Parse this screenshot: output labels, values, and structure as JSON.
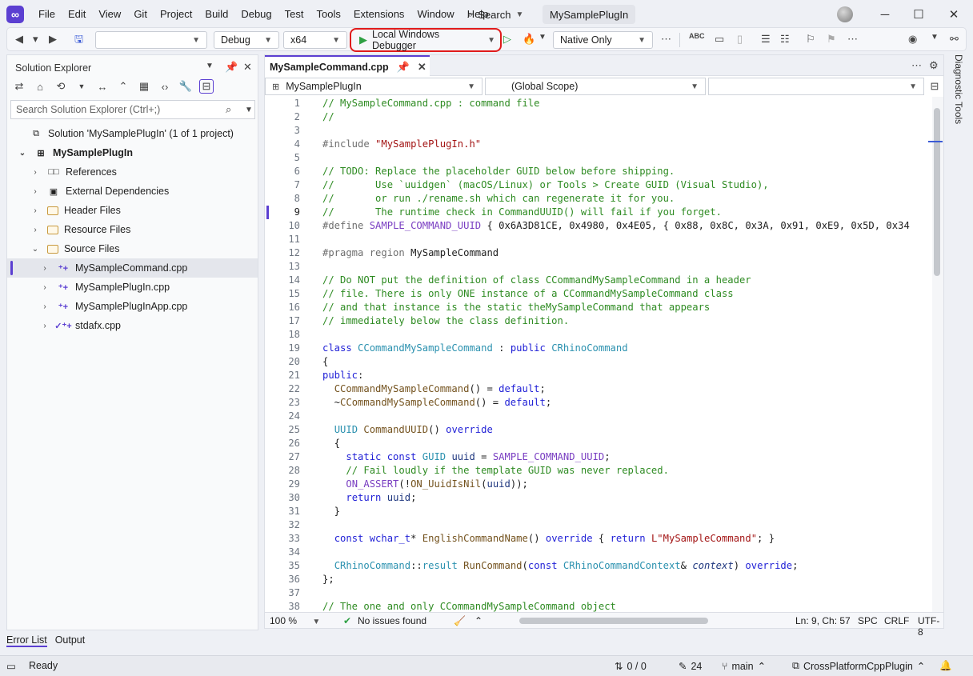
{
  "menu": [
    "File",
    "Edit",
    "View",
    "Git",
    "Project",
    "Build",
    "Debug",
    "Test",
    "Tools",
    "Extensions",
    "Window",
    "Help"
  ],
  "search_label": "Search",
  "solution_name": "MySamplePlugIn",
  "toolbar": {
    "config": "Debug",
    "platform": "x64",
    "debugger": "Local Windows Debugger",
    "debug_mode": "Native Only"
  },
  "solution_explorer": {
    "title": "Solution Explorer",
    "search_placeholder": "Search Solution Explorer (Ctrl+;)",
    "solution_label": "Solution 'MySamplePlugIn' (1 of 1 project)",
    "project": "MySamplePlugIn",
    "items": [
      {
        "label": "References",
        "icon": "references-icon"
      },
      {
        "label": "External Dependencies",
        "icon": "external-dependencies-icon"
      },
      {
        "label": "Header Files",
        "icon": "folder-icon"
      },
      {
        "label": "Resource Files",
        "icon": "folder-icon"
      },
      {
        "label": "Source Files",
        "icon": "folder-icon"
      }
    ],
    "files": [
      {
        "label": "MySampleCommand.cpp",
        "selected": true
      },
      {
        "label": "MySamplePlugIn.cpp"
      },
      {
        "label": "MySamplePlugInApp.cpp"
      },
      {
        "label": "stdafx.cpp"
      }
    ]
  },
  "bottom_tabs": [
    "Error List",
    "Output"
  ],
  "editor": {
    "tab": "MySampleCommand.cpp",
    "project_combo": "MySamplePlugIn",
    "scope_combo": "(Global Scope)",
    "zoom": "100 %",
    "issues": "No issues found",
    "position": "Ln: 9, Ch: 57",
    "whitespace": "SPC",
    "line_endings": "CRLF",
    "encoding": "UTF-8"
  },
  "code_lines": [
    {
      "n": "1",
      "html": "<span class='c'>// MySampleCommand.cpp : command file</span>"
    },
    {
      "n": "2",
      "html": "<span class='c'>//</span>"
    },
    {
      "n": "3",
      "html": ""
    },
    {
      "n": "4",
      "html": "<span class='pp'>#include</span> <span class='s'>\"MySamplePlugIn.h\"</span>"
    },
    {
      "n": "5",
      "html": ""
    },
    {
      "n": "6",
      "html": "<span class='c'>// TODO: Replace the placeholder GUID below before shipping.</span>"
    },
    {
      "n": "7",
      "html": "<span class='c'>//       Use `uuidgen` (macOS/Linux) or Tools &gt; Create GUID (Visual Studio),</span>"
    },
    {
      "n": "8",
      "html": "<span class='c'>//       or run ./rename.sh which can regenerate it for you.</span>"
    },
    {
      "n": "9",
      "html": "<span class='c'>//       The runtime check in CommandUUID() will fail if you forget.</span>"
    },
    {
      "n": "10",
      "html": "<span class='pp'>#define</span> <span class='m'>SAMPLE_COMMAND_UUID</span> { 0x6A3D81CE, 0x4980, 0x4E05, { 0x88, 0x8C, 0x3A, 0x91, 0xE9, 0x5D, 0x34"
    },
    {
      "n": "11",
      "html": ""
    },
    {
      "n": "12",
      "html": "<span class='pp'>#pragma region</span> MySampleCommand"
    },
    {
      "n": "13",
      "html": ""
    },
    {
      "n": "14",
      "html": "<span class='c'>// Do NOT put the definition of class CCommandMySampleCommand in a header</span>"
    },
    {
      "n": "15",
      "html": "<span class='c'>// file. There is only ONE instance of a CCommandMySampleCommand class</span>"
    },
    {
      "n": "16",
      "html": "<span class='c'>// and that instance is the static theMySampleCommand that appears</span>"
    },
    {
      "n": "17",
      "html": "<span class='c'>// immediately below the class definition.</span>"
    },
    {
      "n": "18",
      "html": ""
    },
    {
      "n": "19",
      "html": "<span class='k'>class</span> <span class='t'>CCommandMySampleCommand</span> : <span class='k'>public</span> <span class='t'>CRhinoCommand</span>"
    },
    {
      "n": "20",
      "html": "{"
    },
    {
      "n": "21",
      "html": "<span class='k'>public</span>:"
    },
    {
      "n": "22",
      "html": "  <span class='f'>CCommandMySampleCommand</span>() = <span class='k'>default</span>;"
    },
    {
      "n": "23",
      "html": "  ~<span class='f'>CCommandMySampleCommand</span>() = <span class='k'>default</span>;"
    },
    {
      "n": "24",
      "html": ""
    },
    {
      "n": "25",
      "html": "  <span class='t'>UUID</span> <span class='f'>CommandUUID</span>() <span class='k'>override</span>"
    },
    {
      "n": "26",
      "html": "  {"
    },
    {
      "n": "27",
      "html": "    <span class='k'>static const</span> <span class='t'>GUID</span> <span class='v'>uuid</span> = <span class='m'>SAMPLE_COMMAND_UUID</span>;"
    },
    {
      "n": "28",
      "html": "    <span class='c'>// Fail loudly if the template GUID was never replaced.</span>"
    },
    {
      "n": "29",
      "html": "    <span class='m'>ON_ASSERT</span>(!<span class='f'>ON_UuidIsNil</span>(<span class='v'>uuid</span>));"
    },
    {
      "n": "30",
      "html": "    <span class='k'>return</span> <span class='v'>uuid</span>;"
    },
    {
      "n": "31",
      "html": "  }"
    },
    {
      "n": "32",
      "html": ""
    },
    {
      "n": "33",
      "html": "  <span class='k'>const</span> <span class='k'>wchar_t</span>* <span class='f'>EnglishCommandName</span>() <span class='k'>override</span> { <span class='k'>return</span> <span class='s'>L\"MySampleCommand\"</span>; }"
    },
    {
      "n": "34",
      "html": ""
    },
    {
      "n": "35",
      "html": "  <span class='t'>CRhinoCommand</span>::<span class='t'>result</span> <span class='f'>RunCommand</span>(<span class='k'>const</span> <span class='t'>CRhinoCommandContext</span>&amp; <span class='p'>context</span>) <span class='k'>override</span>;"
    },
    {
      "n": "36",
      "html": "};"
    },
    {
      "n": "37",
      "html": ""
    },
    {
      "n": "38",
      "html": "<span class='c'>// The one and only CCommandMySampleCommand object</span>"
    }
  ],
  "current_line": "9",
  "diagnostic_tools": "Diagnostic Tools",
  "status": {
    "ready": "Ready",
    "changes": "0 / 0",
    "edits": "24",
    "branch": "main",
    "repo": "CrossPlatformCppPlugin"
  },
  "colors": {
    "accent": "#5b3fd1",
    "debugger_highlight": "#e01b1b",
    "play": "#2ea043"
  }
}
